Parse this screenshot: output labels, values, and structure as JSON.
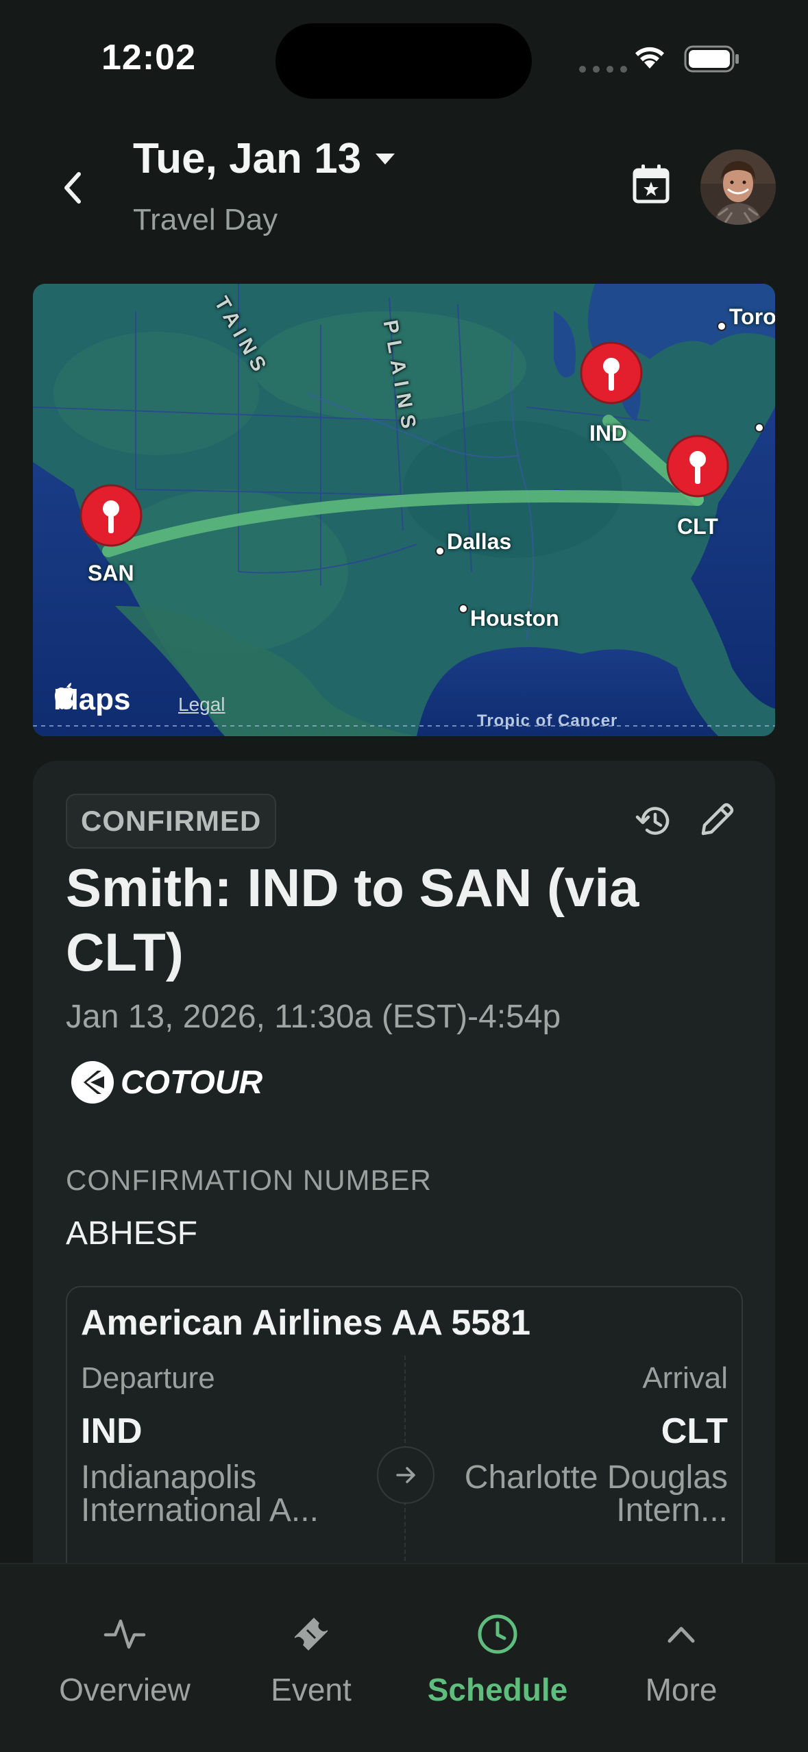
{
  "status_bar": {
    "time": "12:02"
  },
  "header": {
    "title": "Tue, Jan 13",
    "subtitle": "Travel Day"
  },
  "map": {
    "terrain_labels": [
      "TAINS",
      "PLAINS"
    ],
    "cities": [
      "Toro",
      "Dallas",
      "Houston"
    ],
    "pins": [
      "SAN",
      "IND",
      "CLT"
    ],
    "attribution": "Maps",
    "legal": "Legal",
    "tropic_label": "Tropic of Cancer",
    "route_color": "#5fbd7e",
    "pin_color": "#e41f2d"
  },
  "event": {
    "status_badge": "CONFIRMED",
    "title": "Smith: IND to SAN (via CLT)",
    "time": "Jan 13, 2026, 11:30a (EST)-4:54p",
    "logo_text": "COTOUR",
    "confirmation_label": "CONFIRMATION NUMBER",
    "confirmation_value": "ABHESF"
  },
  "flight": {
    "title": "American Airlines AA 5581",
    "departure_label": "Departure",
    "arrival_label": "Arrival",
    "departure_code": "IND",
    "arrival_code": "CLT",
    "departure_airport": "Indianapolis International A...",
    "arrival_airport": "Charlotte Douglas Intern..."
  },
  "tabs": [
    {
      "label": "Overview",
      "icon": "activity-icon",
      "active": false
    },
    {
      "label": "Event",
      "icon": "ticket-icon",
      "active": false
    },
    {
      "label": "Schedule",
      "icon": "clock-icon",
      "active": true
    },
    {
      "label": "More",
      "icon": "chevron-up-icon",
      "active": false
    }
  ],
  "colors": {
    "accent": "#5fbd7e",
    "background": "#151918",
    "card": "#1d2322"
  }
}
